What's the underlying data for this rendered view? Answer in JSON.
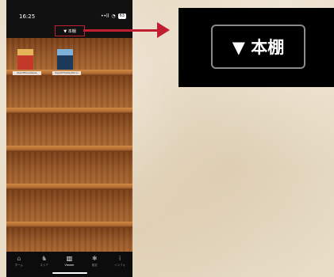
{
  "status": {
    "time": "16:25",
    "signal": "••ll",
    "wifi": "◔",
    "battery": "63"
  },
  "nav": {
    "bookshelf_label": "▼ 本棚",
    "right_label": "···"
  },
  "books": [
    {
      "title": "StarofPlanetGaia",
      "cover_color": "#c43a2a",
      "accent": "#e8b45a"
    },
    {
      "title": "SignOfTheSkyMirror",
      "cover_color": "#1c3a5a",
      "accent": "#7fb0d8"
    }
  ],
  "tabs": [
    {
      "label": "ホーム",
      "icon": "⌂"
    },
    {
      "label": "ストア",
      "icon": "♞"
    },
    {
      "label": "Viewer",
      "icon": "▥"
    },
    {
      "label": "設定",
      "icon": "✱"
    },
    {
      "label": "インフォ",
      "icon": "i"
    }
  ],
  "zoom": {
    "label": "▼ 本棚"
  },
  "colors": {
    "highlight": "#c21e32",
    "shelf": "#9a5a27"
  }
}
